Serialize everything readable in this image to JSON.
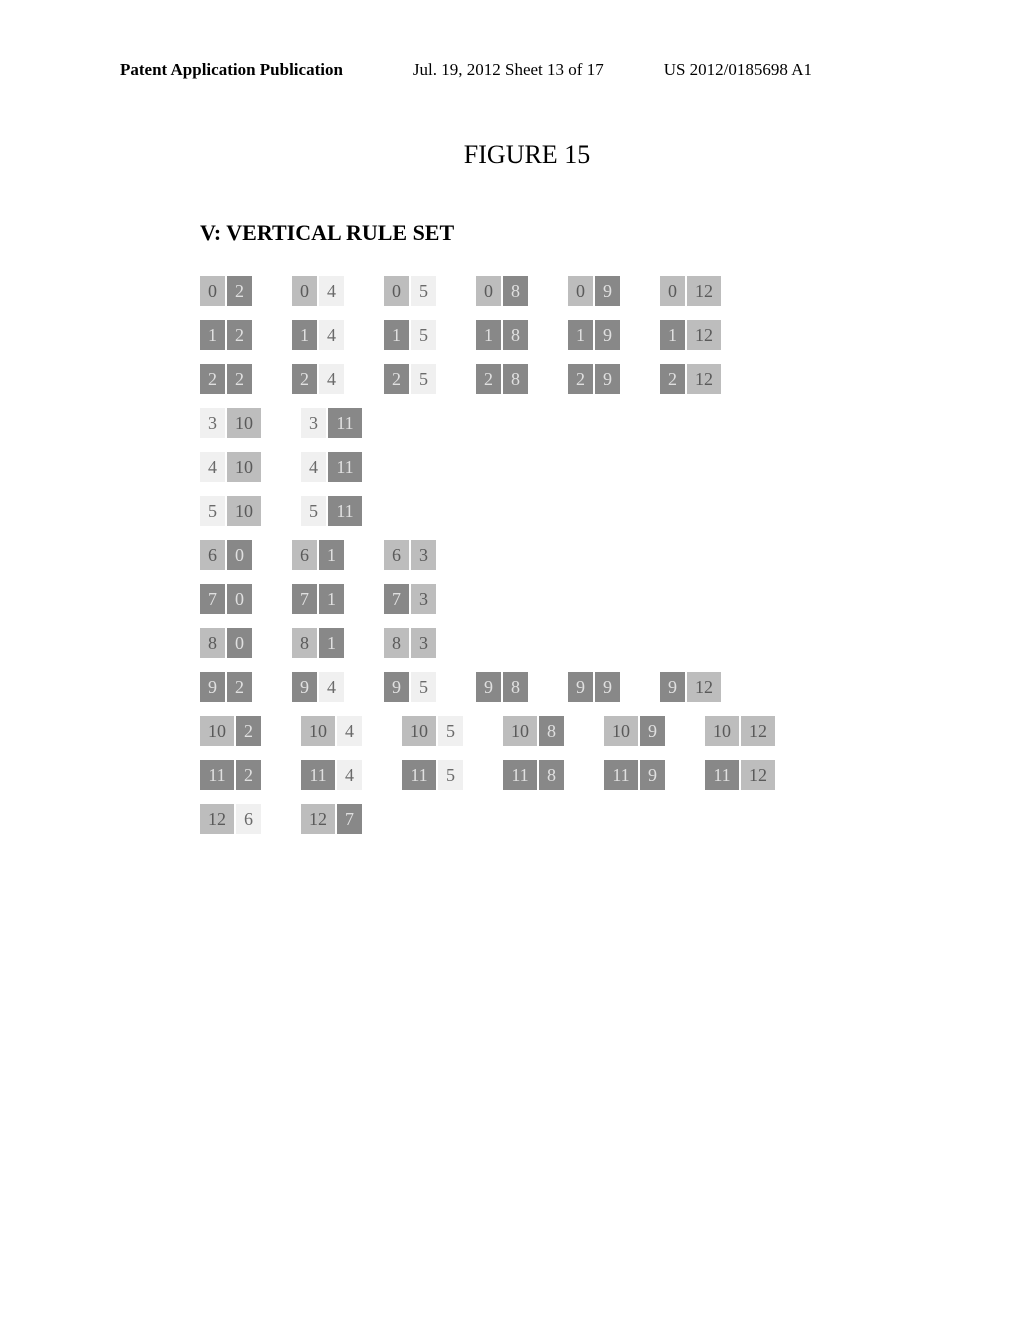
{
  "header": {
    "left": "Patent Application Publication",
    "mid": "Jul. 19, 2012  Sheet 13 of 17",
    "right": "US 2012/0185698 A1"
  },
  "figure_label": "FIGURE 15",
  "section_title": "V: VERTICAL RULE SET",
  "rows": [
    [
      {
        "a": "0",
        "b": "2",
        "as": "med",
        "bs": "dark"
      },
      {
        "a": "0",
        "b": "4",
        "as": "med",
        "bs": "light"
      },
      {
        "a": "0",
        "b": "5",
        "as": "med",
        "bs": "light"
      },
      {
        "a": "0",
        "b": "8",
        "as": "med",
        "bs": "dark"
      },
      {
        "a": "0",
        "b": "9",
        "as": "med",
        "bs": "dark"
      },
      {
        "a": "0",
        "b": "12",
        "as": "med",
        "bs": "med"
      }
    ],
    [
      {
        "a": "1",
        "b": "2",
        "as": "dark",
        "bs": "dark"
      },
      {
        "a": "1",
        "b": "4",
        "as": "dark",
        "bs": "light"
      },
      {
        "a": "1",
        "b": "5",
        "as": "dark",
        "bs": "light"
      },
      {
        "a": "1",
        "b": "8",
        "as": "dark",
        "bs": "dark"
      },
      {
        "a": "1",
        "b": "9",
        "as": "dark",
        "bs": "dark"
      },
      {
        "a": "1",
        "b": "12",
        "as": "dark",
        "bs": "med"
      }
    ],
    [
      {
        "a": "2",
        "b": "2",
        "as": "dark",
        "bs": "dark"
      },
      {
        "a": "2",
        "b": "4",
        "as": "dark",
        "bs": "light"
      },
      {
        "a": "2",
        "b": "5",
        "as": "dark",
        "bs": "light"
      },
      {
        "a": "2",
        "b": "8",
        "as": "dark",
        "bs": "dark"
      },
      {
        "a": "2",
        "b": "9",
        "as": "dark",
        "bs": "dark"
      },
      {
        "a": "2",
        "b": "12",
        "as": "dark",
        "bs": "med"
      }
    ],
    [
      {
        "a": "3",
        "b": "10",
        "as": "light",
        "bs": "med"
      },
      {
        "a": "3",
        "b": "11",
        "as": "light",
        "bs": "dark"
      }
    ],
    [
      {
        "a": "4",
        "b": "10",
        "as": "light",
        "bs": "med"
      },
      {
        "a": "4",
        "b": "11",
        "as": "light",
        "bs": "dark"
      }
    ],
    [
      {
        "a": "5",
        "b": "10",
        "as": "light",
        "bs": "med"
      },
      {
        "a": "5",
        "b": "11",
        "as": "light",
        "bs": "dark"
      }
    ],
    [
      {
        "a": "6",
        "b": "0",
        "as": "med",
        "bs": "dark"
      },
      {
        "a": "6",
        "b": "1",
        "as": "med",
        "bs": "dark"
      },
      {
        "a": "6",
        "b": "3",
        "as": "med",
        "bs": "med"
      }
    ],
    [
      {
        "a": "7",
        "b": "0",
        "as": "dark",
        "bs": "dark"
      },
      {
        "a": "7",
        "b": "1",
        "as": "dark",
        "bs": "dark"
      },
      {
        "a": "7",
        "b": "3",
        "as": "dark",
        "bs": "med"
      }
    ],
    [
      {
        "a": "8",
        "b": "0",
        "as": "med",
        "bs": "dark"
      },
      {
        "a": "8",
        "b": "1",
        "as": "med",
        "bs": "dark"
      },
      {
        "a": "8",
        "b": "3",
        "as": "med",
        "bs": "med"
      }
    ],
    [
      {
        "a": "9",
        "b": "2",
        "as": "dark",
        "bs": "dark"
      },
      {
        "a": "9",
        "b": "4",
        "as": "dark",
        "bs": "light"
      },
      {
        "a": "9",
        "b": "5",
        "as": "dark",
        "bs": "light"
      },
      {
        "a": "9",
        "b": "8",
        "as": "dark",
        "bs": "dark"
      },
      {
        "a": "9",
        "b": "9",
        "as": "dark",
        "bs": "dark"
      },
      {
        "a": "9",
        "b": "12",
        "as": "dark",
        "bs": "med"
      }
    ],
    [
      {
        "a": "10",
        "b": "2",
        "as": "med",
        "bs": "dark"
      },
      {
        "a": "10",
        "b": "4",
        "as": "med",
        "bs": "light"
      },
      {
        "a": "10",
        "b": "5",
        "as": "med",
        "bs": "light"
      },
      {
        "a": "10",
        "b": "8",
        "as": "med",
        "bs": "dark"
      },
      {
        "a": "10",
        "b": "9",
        "as": "med",
        "bs": "dark"
      },
      {
        "a": "10",
        "b": "12",
        "as": "med",
        "bs": "med"
      }
    ],
    [
      {
        "a": "11",
        "b": "2",
        "as": "dark",
        "bs": "dark"
      },
      {
        "a": "11",
        "b": "4",
        "as": "dark",
        "bs": "light"
      },
      {
        "a": "11",
        "b": "5",
        "as": "dark",
        "bs": "light"
      },
      {
        "a": "11",
        "b": "8",
        "as": "dark",
        "bs": "dark"
      },
      {
        "a": "11",
        "b": "9",
        "as": "dark",
        "bs": "dark"
      },
      {
        "a": "11",
        "b": "12",
        "as": "dark",
        "bs": "med"
      }
    ],
    [
      {
        "a": "12",
        "b": "6",
        "as": "med",
        "bs": "light"
      },
      {
        "a": "12",
        "b": "7",
        "as": "med",
        "bs": "dark"
      }
    ]
  ]
}
